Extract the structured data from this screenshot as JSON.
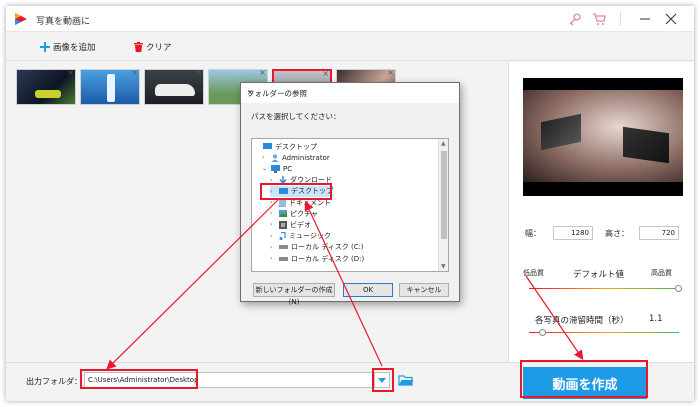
{
  "window": {
    "title": "写真を動画に"
  },
  "toolbar": {
    "add_label": "画像を追加",
    "clear_label": "クリア"
  },
  "thumbnails": [
    {
      "name": "night-car"
    },
    {
      "name": "bottle-art"
    },
    {
      "name": "white-car"
    },
    {
      "name": "landscape"
    },
    {
      "name": "car-selected"
    },
    {
      "name": "laptop"
    }
  ],
  "dialog": {
    "title": "フォルダーの参照",
    "close": "✕",
    "prompt": "パスを選択してください：",
    "tree": [
      {
        "label": "デスクトップ",
        "icon": "desktop-icon",
        "level": 0,
        "chevron": ""
      },
      {
        "label": "Administrator",
        "icon": "user-icon",
        "level": 1,
        "chevron": "›"
      },
      {
        "label": "PC",
        "icon": "pc-icon",
        "level": 1,
        "chevron": "⌄"
      },
      {
        "label": "ダウンロード",
        "icon": "download-icon",
        "level": 2,
        "chevron": "›"
      },
      {
        "label": "デスクトップ",
        "icon": "desktop-icon",
        "level": 2,
        "chevron": "›"
      },
      {
        "label": "ドキュメント",
        "icon": "document-icon",
        "level": 2,
        "chevron": "›"
      },
      {
        "label": "ピクチャ",
        "icon": "picture-icon",
        "level": 2,
        "chevron": "›"
      },
      {
        "label": "ビデオ",
        "icon": "video-icon",
        "level": 2,
        "chevron": "›"
      },
      {
        "label": "ミュージック",
        "icon": "music-icon",
        "level": 2,
        "chevron": "›"
      },
      {
        "label": "ローカル ディスク (C:)",
        "icon": "disk-icon",
        "level": 2,
        "chevron": "›"
      },
      {
        "label": "ローカル ディスク (D:)",
        "icon": "disk-icon",
        "level": 2,
        "chevron": "›"
      }
    ],
    "new_folder": "新しいフォルダーの作成(N)",
    "ok": "OK",
    "cancel": "キャンセル"
  },
  "settings": {
    "width_label": "幅：",
    "width_value": "1280",
    "height_label": "高さ：",
    "height_value": "720",
    "quality_low": "低品質",
    "quality_default": "デフォルト値",
    "quality_high": "高品質",
    "quality_level": 1.0,
    "duration_label": "各写真の滞留時間（秒）",
    "duration_value": "1.1"
  },
  "output": {
    "label": "出力フォルダ：",
    "path": "C:\\Users\\Administrator\\Desktop"
  },
  "create_button": "動画を作成",
  "colors": {
    "accent": "#1e9be6",
    "highlight": "#e8192c"
  }
}
